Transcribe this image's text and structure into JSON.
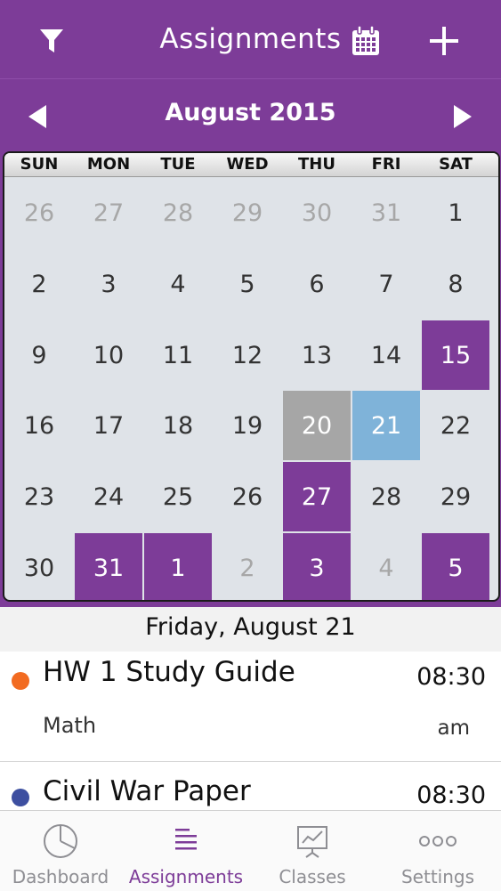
{
  "header": {
    "title": "Assignments"
  },
  "calendar": {
    "month_label": "August 2015",
    "weekdays": [
      "SUN",
      "MON",
      "TUE",
      "WED",
      "THU",
      "FRI",
      "SAT"
    ],
    "days": [
      [
        "26",
        "27",
        "28",
        "29",
        "30",
        "31",
        "1"
      ],
      [
        "2",
        "3",
        "4",
        "5",
        "6",
        "7",
        "8"
      ],
      [
        "9",
        "10",
        "11",
        "12",
        "13",
        "14",
        "15"
      ],
      [
        "16",
        "17",
        "18",
        "19",
        "20",
        "21",
        "22"
      ],
      [
        "23",
        "24",
        "25",
        "26",
        "27",
        "28",
        "29"
      ],
      [
        "30",
        "31",
        "1",
        "2",
        "3",
        "4",
        "5"
      ]
    ],
    "colors": {
      "due": "#7d3c98",
      "today": "#a6a6a6",
      "selected": "#7fb3d9"
    }
  },
  "selected_date_label": "Friday, August 21",
  "assignments": [
    {
      "name": "HW 1 Study Guide",
      "subject": "Math",
      "time": "08:30",
      "ampm": "am",
      "color": "#f26b21"
    },
    {
      "name": "Civil War Paper",
      "subject": "",
      "time": "08:30",
      "ampm": "",
      "color": "#3d4fa0"
    }
  ],
  "tabs": [
    {
      "label": "Dashboard",
      "icon": "pie-chart-icon"
    },
    {
      "label": "Assignments",
      "icon": "list-icon"
    },
    {
      "label": "Classes",
      "icon": "presentation-board-icon"
    },
    {
      "label": "Settings",
      "icon": "more-dots-icon"
    }
  ],
  "accent_color": "#7d3c98"
}
